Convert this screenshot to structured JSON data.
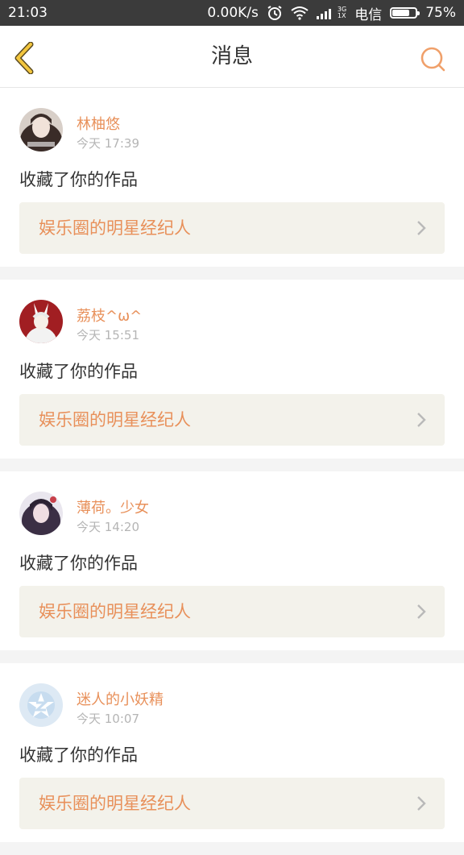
{
  "status": {
    "time": "21:03",
    "speed": "0.00K/s",
    "net_top": "3G",
    "net_bottom": "1X",
    "carrier": "电信",
    "battery": "75%",
    "battery_level": 0.75
  },
  "nav": {
    "title": "消息"
  },
  "colors": {
    "accent": "#e8905a",
    "back_arrow": "#f3c63e"
  },
  "messages": [
    {
      "name": "林柚悠",
      "time": "今天 17:39",
      "action": "收藏了你的作品",
      "work": "娱乐圈的明星经纪人"
    },
    {
      "name": "荔枝^ω^",
      "time": "今天 15:51",
      "action": "收藏了你的作品",
      "work": "娱乐圈的明星经纪人"
    },
    {
      "name": "薄荷。少女",
      "time": "今天 14:20",
      "action": "收藏了你的作品",
      "work": "娱乐圈的明星经纪人"
    },
    {
      "name": "迷人的小妖精",
      "time": "今天 10:07",
      "action": "收藏了你的作品",
      "work": "娱乐圈的明星经纪人"
    }
  ]
}
